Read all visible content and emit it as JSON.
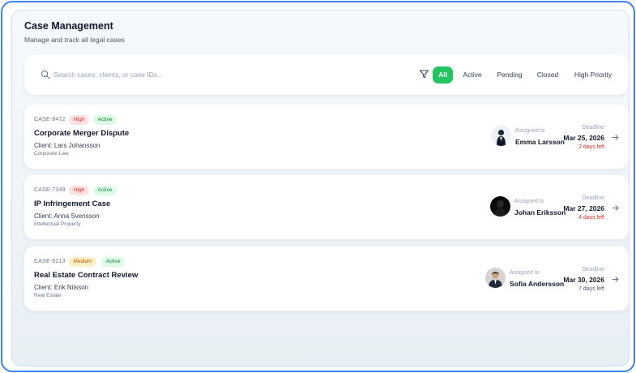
{
  "header": {
    "title": "Case Management",
    "subtitle": "Manage and track all legal cases"
  },
  "search": {
    "placeholder": "Search cases, clients, or case IDs...",
    "icon": "search-icon"
  },
  "filters": {
    "icon": "filter-icon",
    "chips": [
      {
        "label": "All",
        "selected": true
      },
      {
        "label": "Active",
        "selected": false
      },
      {
        "label": "Pending",
        "selected": false
      },
      {
        "label": "Closed",
        "selected": false
      },
      {
        "label": "High Priority",
        "selected": false
      }
    ]
  },
  "cases": [
    {
      "id": "CASE-8472",
      "priority": "High",
      "status": "Active",
      "title": "Corporate Merger Dispute",
      "client": "Client: Lars Johansson",
      "area": "Corporate Law",
      "assigned_label": "Assigned to",
      "assignee": "Emma Larsson",
      "deadline_label": "Deadline",
      "deadline": "Mar 25, 2026",
      "days_left": "2 days left",
      "urgent": true
    },
    {
      "id": "CASE-7349",
      "priority": "High",
      "status": "Active",
      "title": "IP Infringement Case",
      "client": "Client: Anna Svensson",
      "area": "Intellectual Property",
      "assigned_label": "Assigned to",
      "assignee": "Johan Eriksson",
      "deadline_label": "Deadline",
      "deadline": "Mar 27, 2026",
      "days_left": "4 days left",
      "urgent": true
    },
    {
      "id": "CASE-6213",
      "priority": "Medium",
      "status": "Active",
      "title": "Real Estate Contract Review",
      "client": "Client: Erik Nilsson",
      "area": "Real Estate",
      "assigned_label": "Assigned to",
      "assignee": "Sofia Andersson",
      "deadline_label": "Deadline",
      "deadline": "Mar 30, 2026",
      "days_left": "7 days left",
      "urgent": false
    }
  ],
  "colors": {
    "accent": "#22c55e",
    "frame": "#3b82f6",
    "urgent": "#dc2626"
  }
}
